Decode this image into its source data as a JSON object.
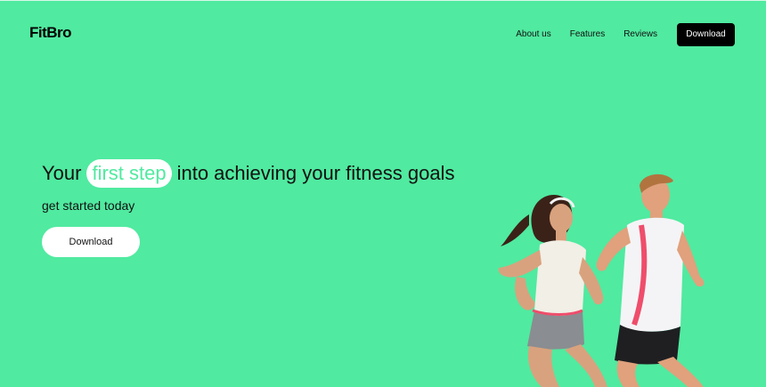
{
  "brand": {
    "name": "FitBro"
  },
  "nav": {
    "items": [
      {
        "label": "About us"
      },
      {
        "label": "Features"
      },
      {
        "label": "Reviews"
      }
    ],
    "cta_label": "Download"
  },
  "hero": {
    "headline_before": "Your",
    "headline_highlight": "first step",
    "headline_after": "into achieving your fitness goals",
    "subheading": "get started today",
    "cta_label": "Download"
  },
  "colors": {
    "background": "#50EAA0",
    "highlight_pill": "#FFFFFF",
    "nav_button": "#000000"
  }
}
